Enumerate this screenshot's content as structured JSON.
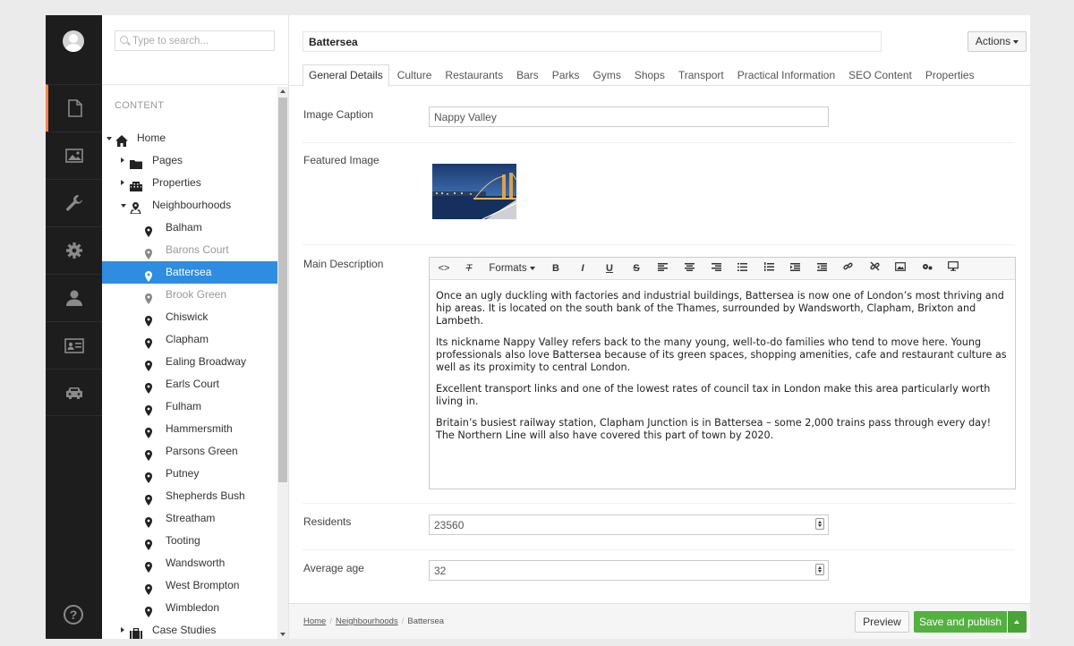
{
  "search": {
    "placeholder": "Type to search..."
  },
  "tree": {
    "section_label": "CONTENT",
    "nodes": [
      {
        "label": "Home"
      },
      {
        "label": "Pages"
      },
      {
        "label": "Properties"
      },
      {
        "label": "Neighbourhoods"
      },
      {
        "label": "Balham"
      },
      {
        "label": "Barons Court"
      },
      {
        "label": "Battersea"
      },
      {
        "label": "Brook Green"
      },
      {
        "label": "Chiswick"
      },
      {
        "label": "Clapham"
      },
      {
        "label": "Ealing Broadway"
      },
      {
        "label": "Earls Court"
      },
      {
        "label": "Fulham"
      },
      {
        "label": "Hammersmith"
      },
      {
        "label": "Parsons Green"
      },
      {
        "label": "Putney"
      },
      {
        "label": "Shepherds Bush"
      },
      {
        "label": "Streatham"
      },
      {
        "label": "Tooting"
      },
      {
        "label": "Wandsworth"
      },
      {
        "label": "West Brompton"
      },
      {
        "label": "Wimbledon"
      },
      {
        "label": "Case Studies"
      }
    ]
  },
  "header": {
    "node_name": "Battersea",
    "actions_label": "Actions"
  },
  "tabs": [
    {
      "label": "General Details"
    },
    {
      "label": "Culture"
    },
    {
      "label": "Restaurants"
    },
    {
      "label": "Bars"
    },
    {
      "label": "Parks"
    },
    {
      "label": "Gyms"
    },
    {
      "label": "Shops"
    },
    {
      "label": "Transport"
    },
    {
      "label": "Practical Information"
    },
    {
      "label": "SEO Content"
    },
    {
      "label": "Properties"
    }
  ],
  "fields": {
    "image_caption": {
      "label": "Image Caption",
      "value": "Nappy Valley"
    },
    "featured_image": {
      "label": "Featured Image"
    },
    "main_description": {
      "label": "Main Description",
      "formats_label": "Formats",
      "paragraphs": [
        "Once an ugly duckling with factories and industrial buildings, Battersea is now one of London’s most thriving and hip areas. It is located on the south bank of the Thames, surrounded by Wandsworth, Clapham, Brixton and Lambeth.",
        "Its nickname Nappy Valley refers back to the many young, well-to-do families who tend to move here. Young professionals also love Battersea because of its green spaces, shopping amenities, cafe and restaurant culture as well as its proximity to central London.",
        "Excellent transport links and one of the lowest rates of council tax in London make this area particularly worth living in.",
        "Britain’s busiest railway station, Clapham Junction is in Battersea – some 2,000 trains pass through every day! The Northern Line will also have covered this part of town by 2020."
      ]
    },
    "residents": {
      "label": "Residents",
      "value": "23560"
    },
    "average_age": {
      "label": "Average age",
      "value": "32"
    }
  },
  "footer": {
    "breadcrumb": [
      "Home",
      "Neighbourhoods",
      "Battersea"
    ],
    "preview_label": "Preview",
    "publish_label": "Save and publish"
  },
  "colors": {
    "accent_active": "#f5814f",
    "selected_node": "#2e8de0",
    "publish_green": "#53b13f",
    "sidebar_dark": "#1d1d1d"
  }
}
